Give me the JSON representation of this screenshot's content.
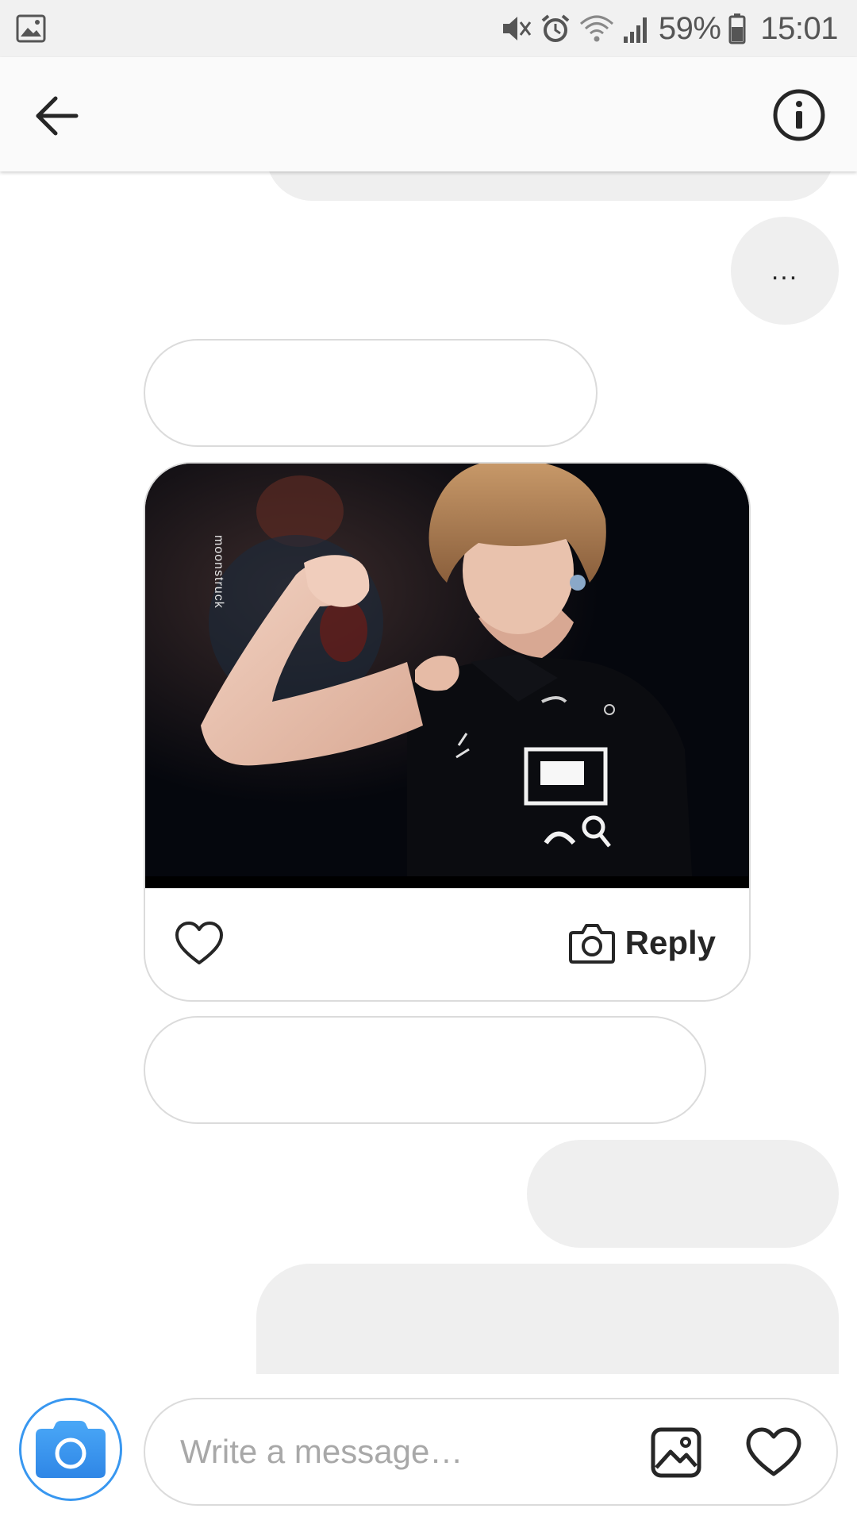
{
  "status_bar": {
    "battery": "59%",
    "time": "15:01",
    "icons": [
      "gallery-notification-icon",
      "mute-vibrate-icon",
      "alarm-icon",
      "wifi-icon",
      "signal-icon",
      "battery-icon"
    ]
  },
  "header": {
    "back_icon": "arrow-left-icon",
    "info_icon": "info-icon"
  },
  "chat": {
    "typing_indicator": "..."
  },
  "post": {
    "watermark": "moonstruck",
    "reply_label": "Reply",
    "like_icon": "heart-outline-icon",
    "reply_icon": "camera-outline-icon"
  },
  "composer": {
    "placeholder": "Write a message…",
    "value": "",
    "camera_icon": "camera-icon",
    "gallery_icon": "image-icon",
    "heart_icon": "heart-outline-icon"
  },
  "colors": {
    "accent_blue": "#3897f0",
    "bubble_gray": "#efefef",
    "border_gray": "#dbdbdb",
    "text_dark": "#262626",
    "placeholder_gray": "#a8a8a8",
    "status_bar_bg": "#f1f1f1"
  }
}
